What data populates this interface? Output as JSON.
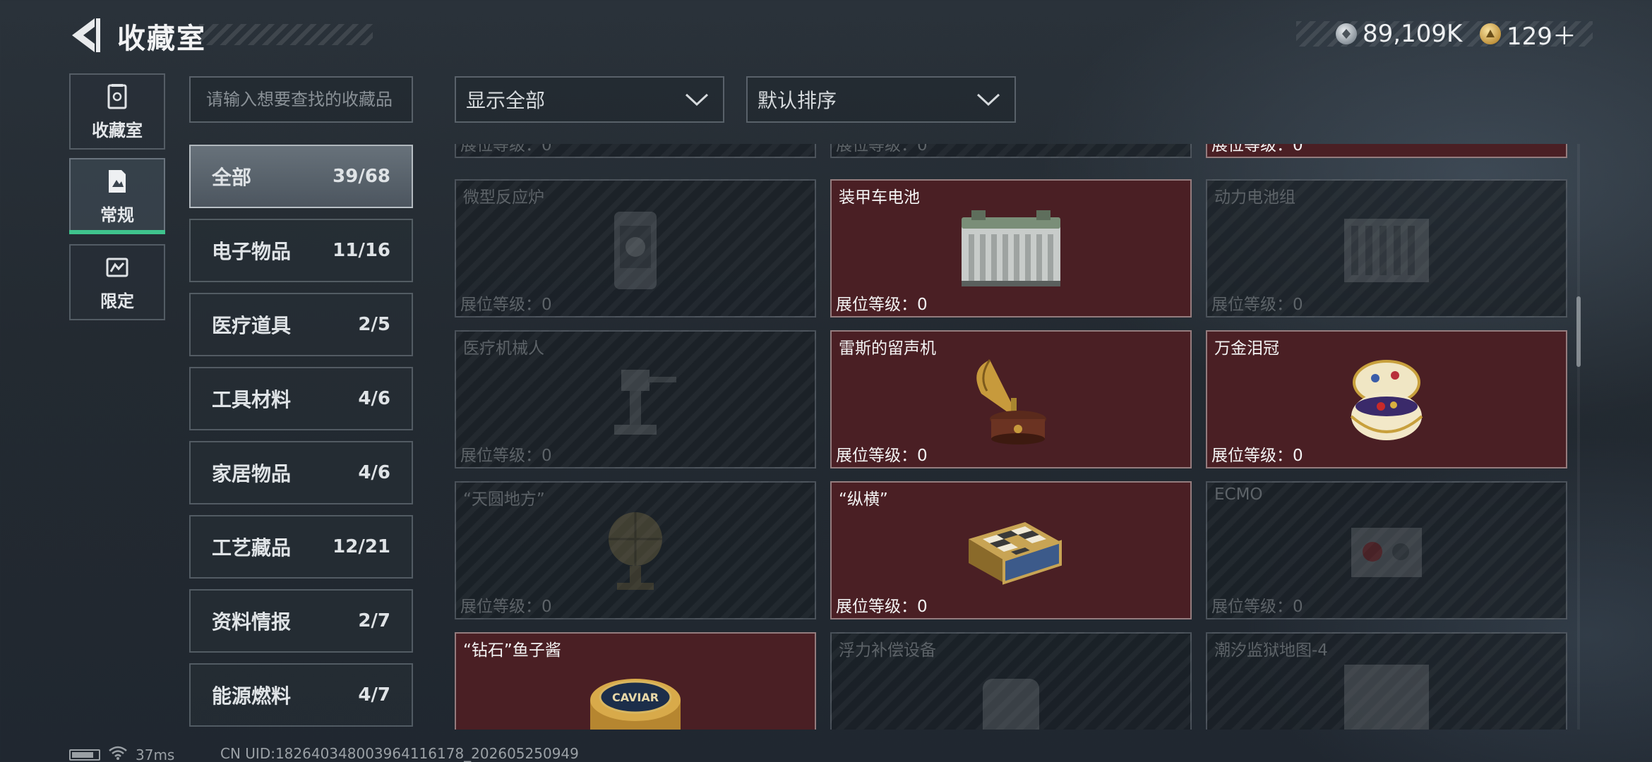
{
  "header": {
    "title": "收藏室",
    "silver_amount": "89,109K",
    "gold_amount": "129＋"
  },
  "side_nav": [
    {
      "label": "收藏室",
      "icon": "vault-icon"
    },
    {
      "label": "常规",
      "icon": "document-icon",
      "active": true
    },
    {
      "label": "限定",
      "icon": "limited-icon"
    }
  ],
  "search": {
    "placeholder": "请输入想要查找的收藏品",
    "value": ""
  },
  "categories": [
    {
      "name": "全部",
      "count": "39/68",
      "active": true
    },
    {
      "name": "电子物品",
      "count": "11/16"
    },
    {
      "name": "医疗道具",
      "count": "2/5"
    },
    {
      "name": "工具材料",
      "count": "4/6"
    },
    {
      "name": "家居物品",
      "count": "4/6"
    },
    {
      "name": "工艺藏品",
      "count": "12/21"
    },
    {
      "name": "资料情报",
      "count": "2/7"
    },
    {
      "name": "能源燃料",
      "count": "4/7"
    }
  ],
  "filter_dropdown": {
    "selected": "显示全部"
  },
  "sort_dropdown": {
    "selected": "默认排序"
  },
  "level_label": "展位等级：0",
  "cards": [
    {
      "name": "",
      "owned": false,
      "art": "none"
    },
    {
      "name": "",
      "owned": false,
      "art": "none"
    },
    {
      "name": "",
      "owned": true,
      "art": "none"
    },
    {
      "name": "微型反应炉",
      "owned": false,
      "art": "reactor"
    },
    {
      "name": "装甲车电池",
      "owned": true,
      "art": "battery"
    },
    {
      "name": "动力电池组",
      "owned": false,
      "art": "batterypack"
    },
    {
      "name": "医疗机械人",
      "owned": false,
      "art": "robot"
    },
    {
      "name": "雷斯的留声机",
      "owned": true,
      "art": "gramophone"
    },
    {
      "name": "万金泪冠",
      "owned": true,
      "art": "egg"
    },
    {
      "name": "“天圆地方”",
      "owned": false,
      "art": "globe"
    },
    {
      "name": "“纵横”",
      "owned": true,
      "art": "chessbox"
    },
    {
      "name": "ECMO",
      "owned": false,
      "art": "ecmo"
    },
    {
      "name": "“钻石”鱼子酱",
      "owned": true,
      "art": "caviar",
      "caviar_label": "CAVIAR"
    },
    {
      "name": "浮力补偿设备",
      "owned": false,
      "art": "bcd"
    },
    {
      "name": "潮汐监狱地图-4",
      "owned": false,
      "art": "map"
    }
  ],
  "status_bar": {
    "ping": "37ms",
    "uid": "CN UID:1826403480039641161​78_202605250949"
  },
  "colors": {
    "owned_card_bg": "#4a1f24",
    "active_tab_accent": "#3fc38d"
  }
}
